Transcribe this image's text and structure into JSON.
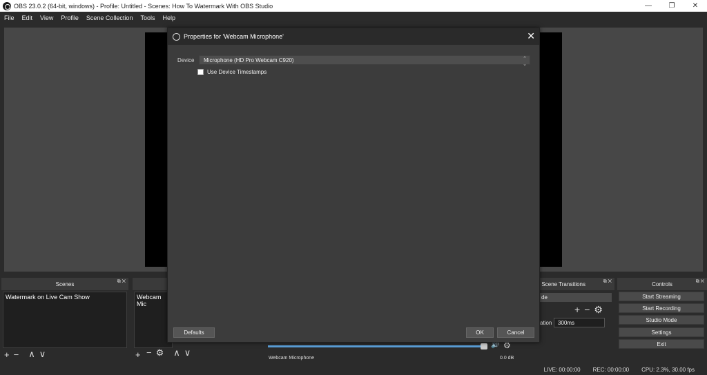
{
  "window": {
    "title": "OBS 23.0.2 (64-bit, windows) - Profile: Untitled - Scenes: How To Watermark With OBS Studio",
    "minimize": "—",
    "maximize": "❐",
    "close": "✕"
  },
  "menu": [
    "File",
    "Edit",
    "View",
    "Profile",
    "Scene Collection",
    "Tools",
    "Help"
  ],
  "scenes_dock": {
    "title": "Scenes",
    "items": [
      "Watermark on Live Cam Show"
    ]
  },
  "sources_dock": {
    "items": [
      "Webcam Mic"
    ]
  },
  "mixer": {
    "level": "0.0 dB",
    "source_label": "Webcam Microphone"
  },
  "transitions_dock": {
    "title": "Scene Transitions",
    "fade_label": "de",
    "duration_label": "ation",
    "duration_value": "300ms"
  },
  "controls_dock": {
    "title": "Controls",
    "buttons": [
      "Start Streaming",
      "Start Recording",
      "Studio Mode",
      "Settings",
      "Exit"
    ]
  },
  "status": {
    "live": "LIVE: 00:00:00",
    "rec": "REC: 00:00:00",
    "cpu": "CPU: 2.3%, 30.00 fps"
  },
  "dialog": {
    "title": "Properties for 'Webcam Microphone'",
    "device_label": "Device",
    "device_value": "Microphone (HD Pro Webcam C920)",
    "timestamps_label": "Use Device Timestamps",
    "timestamps_checked": false,
    "defaults": "Defaults",
    "ok": "OK",
    "cancel": "Cancel"
  },
  "icons": {
    "dock_float": "⧉",
    "dock_close": "✕",
    "add": "+",
    "remove": "−",
    "up": "∧",
    "down": "∨",
    "gear": "⚙",
    "volume": "🔊"
  }
}
